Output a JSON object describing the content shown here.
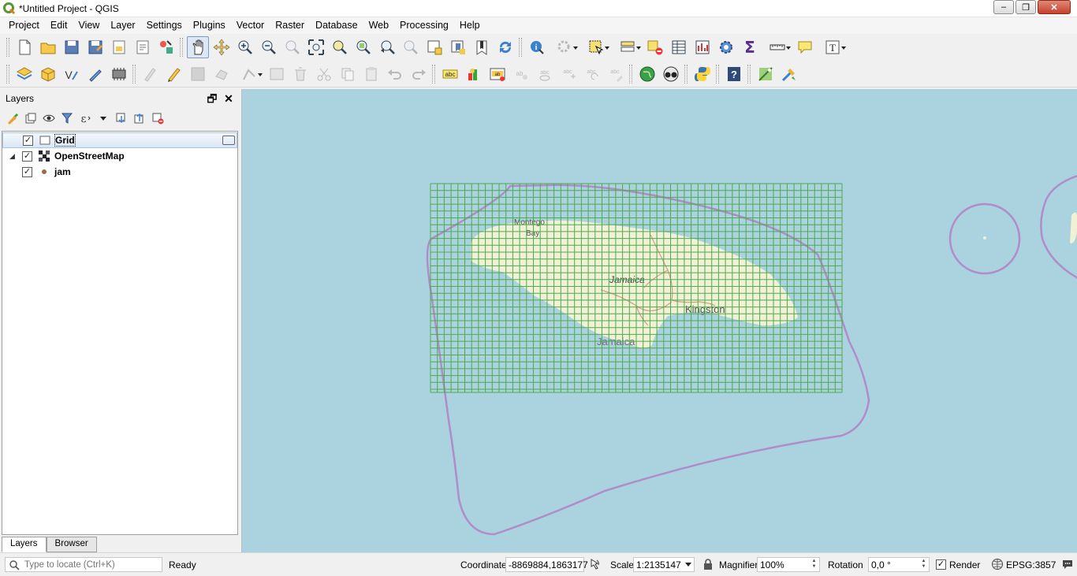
{
  "window": {
    "title": "*Untitled Project - QGIS",
    "minimize": "–",
    "restore": "❐",
    "close": "✕"
  },
  "menu": [
    "Project",
    "Edit",
    "View",
    "Layer",
    "Settings",
    "Plugins",
    "Vector",
    "Raster",
    "Database",
    "Web",
    "Processing",
    "Help"
  ],
  "layers_panel": {
    "title": "Layers",
    "float_btn": "🗗",
    "close_btn": "✕",
    "layers": [
      {
        "name": "Grid",
        "checked": "✓",
        "expander": ""
      },
      {
        "name": "OpenStreetMap",
        "checked": "✓",
        "expander": "◢"
      },
      {
        "name": "jam",
        "checked": "✓",
        "expander": ""
      }
    ],
    "tabs": [
      "Layers",
      "Browser"
    ]
  },
  "map": {
    "labels": {
      "montego": "Montego",
      "bay": "Bay",
      "jamaica_island": "Jamaica",
      "kingston": "Kingston",
      "jamaica_sea": "Jamaica"
    },
    "colors": {
      "sea": "#aad3df",
      "land": "#f1f1d6",
      "grid": "#4daa4d",
      "boundary": "#b08cc8",
      "road": "#d79a86"
    }
  },
  "status": {
    "search_placeholder": "Type to locate (Ctrl+K)",
    "message": "Ready",
    "coordinate_label": "Coordinate",
    "coordinate_value": "-8869884,1863177",
    "scale_label": "Scale",
    "scale_value": "1:2135147",
    "magnifier_label": "Magnifier",
    "magnifier_value": "100%",
    "rotation_label": "Rotation",
    "rotation_value": "0,0 °",
    "render_label": "Render",
    "render_checked": "✓",
    "crs": "EPSG:3857"
  }
}
